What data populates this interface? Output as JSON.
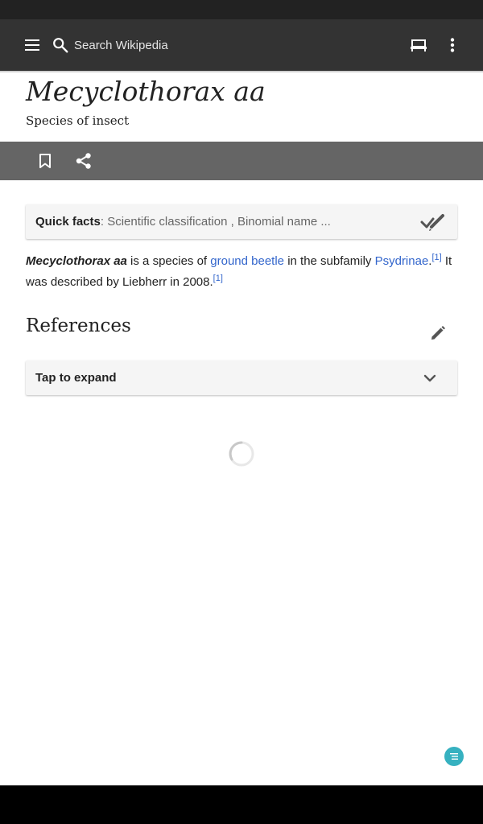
{
  "app_bar": {
    "search_placeholder": "Search Wikipedia",
    "icons": [
      "menu-icon",
      "search-icon",
      "reading-lists-icon",
      "more-vert-icon"
    ]
  },
  "article": {
    "title": "Mecyclothorax aa",
    "description": "Species of insect"
  },
  "actions": {
    "icons": [
      "bookmark-icon",
      "share-icon"
    ]
  },
  "quick_facts": {
    "title": "Quick facts",
    "separator": ":",
    "summary": "Scientific classification , Binomial name ...",
    "icon": "table-check-icon"
  },
  "body": {
    "subject": "Mecyclothorax aa",
    "text_1": " is a species of ",
    "link_1": "ground beetle",
    "text_2": " in the subfamily ",
    "link_2": "Psydrinae",
    "text_3": ".",
    "ref_1": "[1]",
    "text_4": " It was described by Liebherr in 2008.",
    "ref_2": "[1]"
  },
  "references": {
    "title": "References",
    "expand_label": "Tap to expand",
    "icons": [
      "pencil-icon",
      "chevron-down-icon"
    ]
  },
  "fab": {
    "icon": "contents-icon",
    "color": "#36b1c0"
  },
  "colors": {
    "app_bar": "#333333",
    "action_bar": "#656565",
    "link": "#3366cc"
  }
}
